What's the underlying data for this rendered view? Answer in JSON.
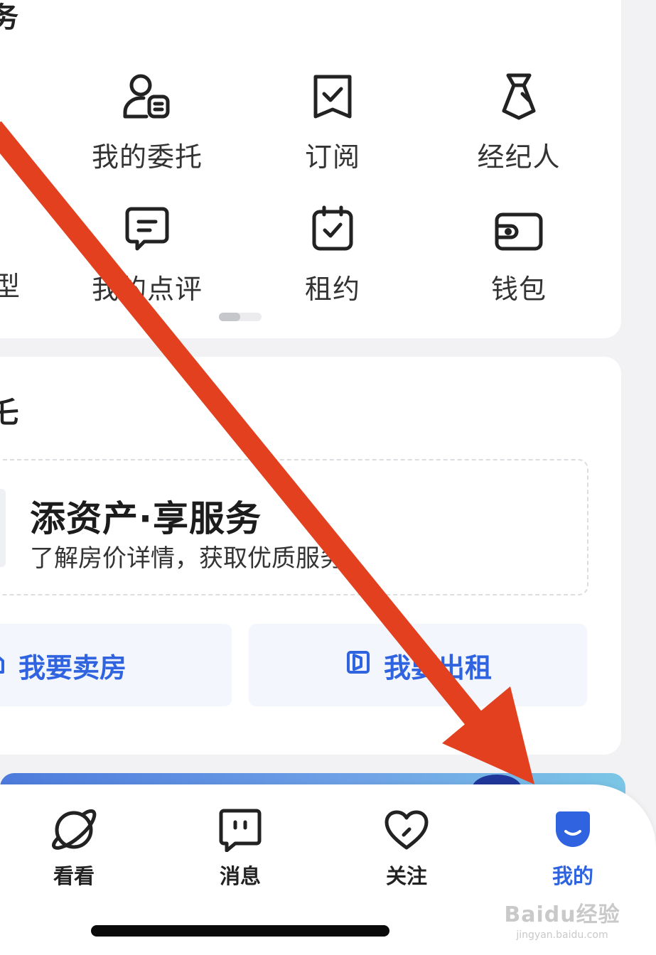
{
  "services_section": {
    "heading_fragment": "务",
    "row1": [
      {
        "label": "我的委托",
        "icon": "person-card-icon"
      },
      {
        "label": "订阅",
        "icon": "bookmark-check-icon"
      },
      {
        "label": "经纪人",
        "icon": "agent-tie-icon"
      }
    ],
    "row2_partial_label": "型",
    "row2": [
      {
        "label": "我的点评",
        "icon": "comment-icon"
      },
      {
        "label": "租约",
        "icon": "calendar-check-icon"
      },
      {
        "label": "钱包",
        "icon": "wallet-icon"
      }
    ]
  },
  "asset_section": {
    "heading_fragment": "乇",
    "promo": {
      "title": "添资产·享服务",
      "subtitle": "了解房价详情，获取优质服务"
    },
    "actions": {
      "sell": "我要卖房",
      "rent": "我要出租"
    }
  },
  "tab_bar": {
    "tabs": [
      {
        "label": "看看",
        "icon": "planet-icon",
        "active": false
      },
      {
        "label": "消息",
        "icon": "message-icon",
        "active": false
      },
      {
        "label": "关注",
        "icon": "heart-icon",
        "active": false
      },
      {
        "label": "我的",
        "icon": "profile-face-icon",
        "active": true
      }
    ]
  },
  "watermark": {
    "line1": "Baidu经验",
    "line2": "jingyan.baidu.com"
  },
  "colors": {
    "accent": "#2f63e0",
    "arrow": "#e3401f"
  }
}
